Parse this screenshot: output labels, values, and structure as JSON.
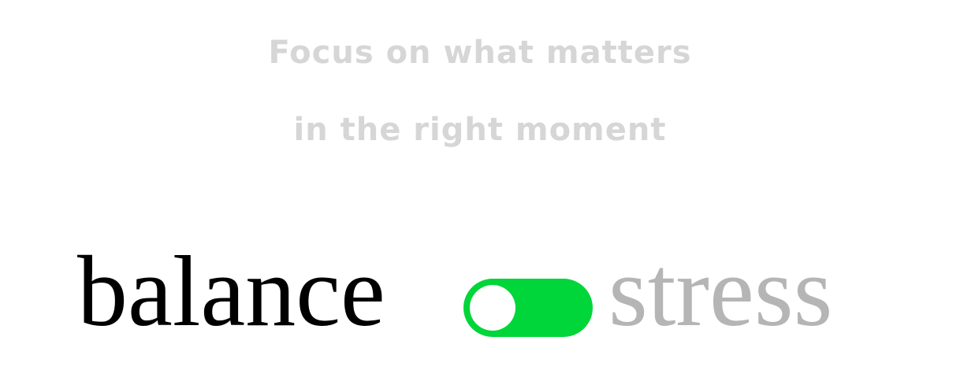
{
  "headline": {
    "line1": "Focus on what matters",
    "line2": "in the right moment"
  },
  "toggle": {
    "left_label": "balance",
    "right_label": "stress",
    "state": "balance",
    "on_color": "#00d53a",
    "knob_color": "#ffffff"
  },
  "colors": {
    "headline": "#d6d6d6",
    "active_label": "#000000",
    "inactive_label": "#b5b5b5"
  }
}
